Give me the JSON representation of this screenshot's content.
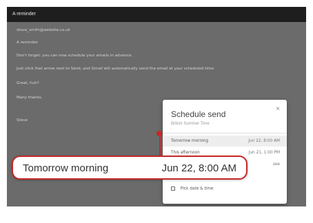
{
  "window": {
    "header_title": "A reminder"
  },
  "email": {
    "to": "steve_smith@website.co.uk",
    "subject": "A reminder",
    "line1": "Don't forget: you can now schedule your emails in advance.",
    "line2": "Just click that arrow next to Send, and Gmail will automatically send the email at your scheduled time.",
    "line3": "Great, huh?",
    "line4": "Many thanks,",
    "signature": "Steve"
  },
  "schedule_popup": {
    "title": "Schedule send",
    "timezone": "British Summer Time",
    "close_symbol": "×",
    "options": [
      {
        "label": "Tomorrow morning",
        "value": "Jun 22, 8:00 AM"
      },
      {
        "label": "This afternoon",
        "value": "Jun 21, 1:00 PM"
      },
      {
        "label": "",
        "value": "see"
      }
    ],
    "pick_label": "Pick date & time"
  },
  "callout": {
    "label": "Tomorrow morning",
    "value": "Jun 22, 8:00 AM"
  },
  "colors": {
    "accent": "#c62828",
    "backdrop": "#6b6b6b",
    "header": "#1e1e1e"
  }
}
